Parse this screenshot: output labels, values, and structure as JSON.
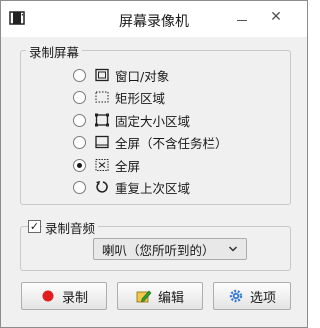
{
  "window": {
    "title": "屏幕录像机"
  },
  "capture_group": {
    "legend": "录制屏幕",
    "options": [
      {
        "label": "窗口/对象",
        "icon": "window-object-icon",
        "selected": false
      },
      {
        "label": "矩形区域",
        "icon": "dashed-rectangle-icon",
        "selected": false
      },
      {
        "label": "固定大小区域",
        "icon": "fixed-size-region-icon",
        "selected": false
      },
      {
        "label": "全屏（不含任务栏）",
        "icon": "fullscreen-no-taskbar-icon",
        "selected": false
      },
      {
        "label": "全屏",
        "icon": "fullscreen-icon",
        "selected": true
      },
      {
        "label": "重复上次区域",
        "icon": "repeat-region-icon",
        "selected": false
      }
    ]
  },
  "audio_group": {
    "legend": "录制音频",
    "checked": true,
    "source_selected": "喇叭（您所听到的）"
  },
  "buttons": {
    "record": "录制",
    "edit": "编辑",
    "options": "选项"
  },
  "colors": {
    "record_dot": "#e02020",
    "edit_icon": "#2f9e2f",
    "options_icon": "#3a7bd5"
  }
}
